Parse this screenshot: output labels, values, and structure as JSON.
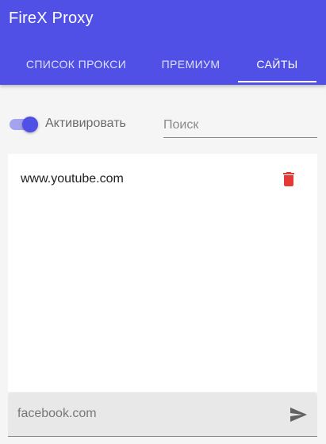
{
  "app": {
    "title": "FireX Proxy"
  },
  "tabs": [
    {
      "label": "СПИСОК ПРОКСИ",
      "active": false
    },
    {
      "label": "ПРЕМИУМ",
      "active": false
    },
    {
      "label": "САЙТЫ",
      "active": true
    }
  ],
  "toolbar": {
    "activate_label": "Активировать",
    "activate_enabled": true,
    "search_placeholder": "Поиск",
    "search_value": ""
  },
  "sites": [
    {
      "domain": "www.youtube.com"
    }
  ],
  "add_site": {
    "placeholder": "facebook.com",
    "value": ""
  },
  "icons": {
    "delete": "trash-icon",
    "send": "send-icon"
  },
  "colors": {
    "primary": "#5050e6",
    "delete": "#e53935",
    "send": "#616161"
  }
}
